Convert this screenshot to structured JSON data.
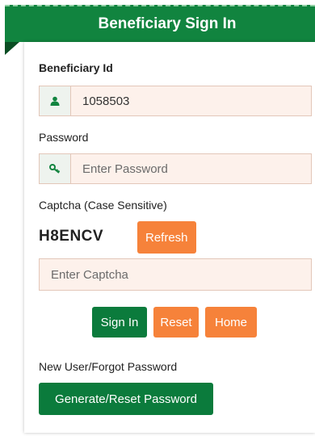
{
  "header": {
    "title": "Beneficiary Sign In"
  },
  "form": {
    "beneficiary_label": "Beneficiary Id",
    "beneficiary_value": "1058503",
    "password_label": "Password",
    "password_placeholder": "Enter Password",
    "captcha_label": "Captcha (Case Sensitive)",
    "captcha_text": "H8ENCV",
    "refresh_label": "Refresh",
    "captcha_placeholder": "Enter Captcha",
    "signin_label": "Sign In",
    "reset_label": "Reset",
    "home_label": "Home",
    "new_user_label": "New User/Forgot Password",
    "generate_label": "Generate/Reset Password"
  },
  "icons": {
    "user": "user-icon",
    "key": "key-icon"
  },
  "colors": {
    "primary_green": "#11843f",
    "button_green": "#0b7b3c",
    "accent_orange": "#f6823a",
    "input_bg": "#fdf1eb"
  }
}
